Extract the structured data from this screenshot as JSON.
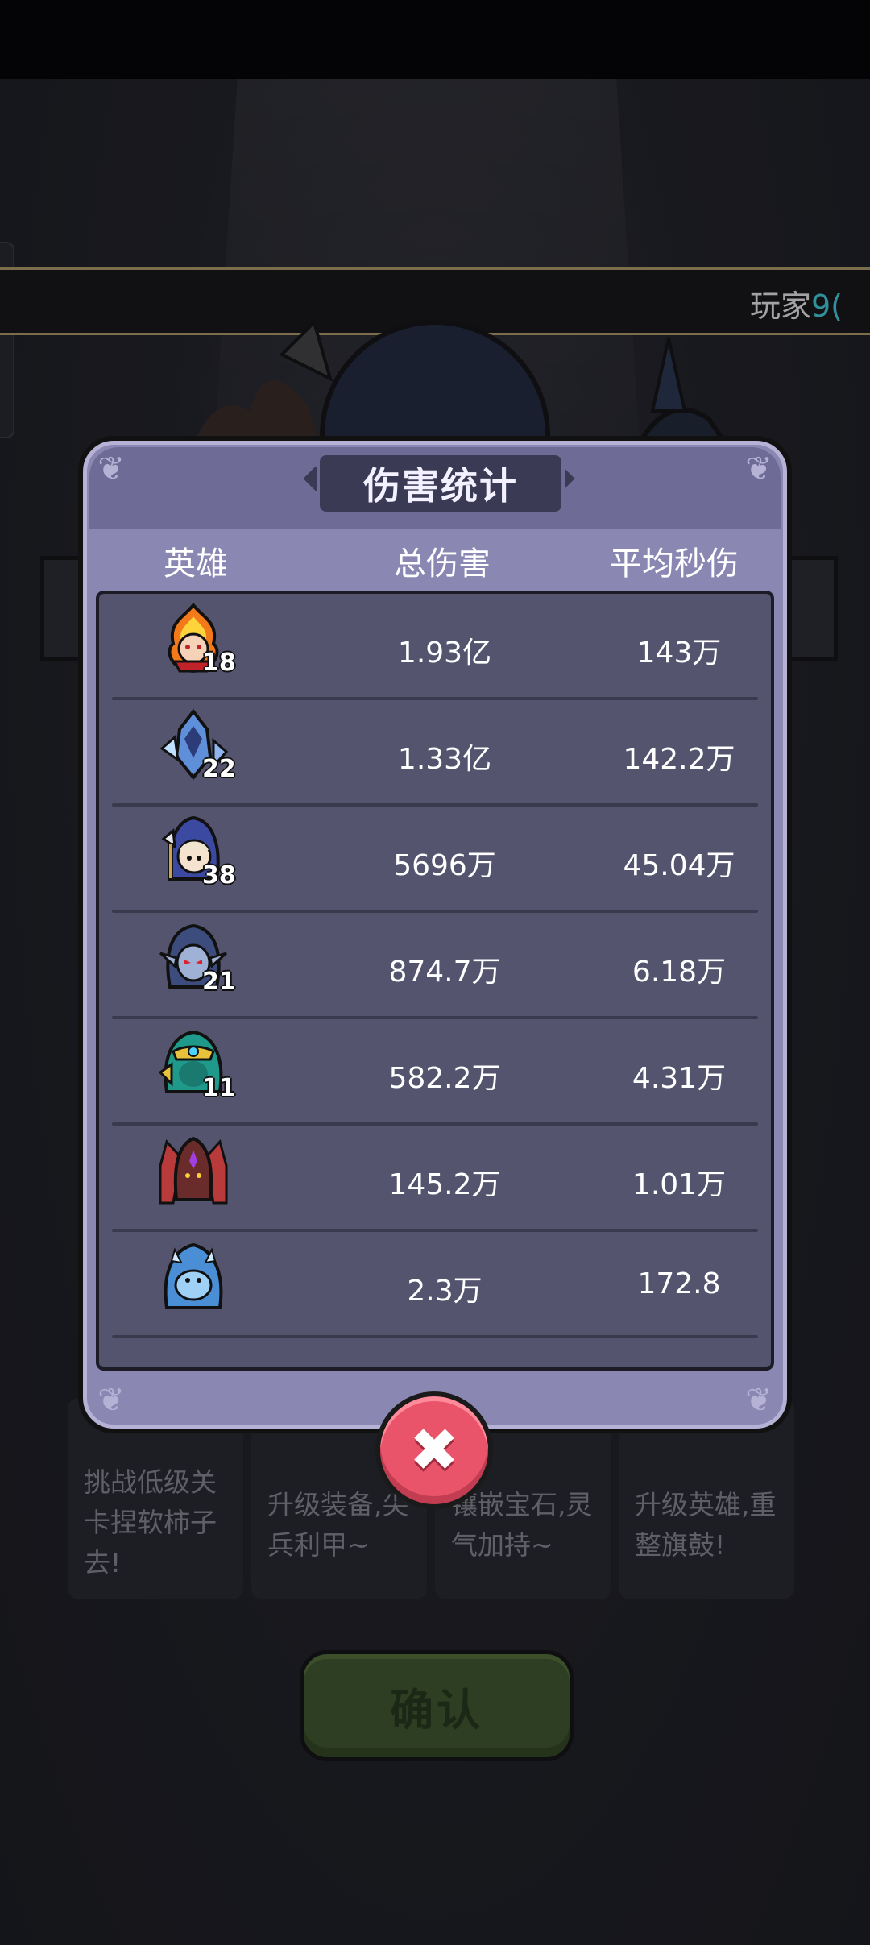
{
  "banner": {
    "player_label": "玩家",
    "player_number": "9("
  },
  "dialog": {
    "title": "伤害统计",
    "headers": {
      "hero": "英雄",
      "total_damage": "总伤害",
      "avg_dps": "平均秒伤"
    },
    "rows": [
      {
        "icon": "fire-hero-icon",
        "level": "18",
        "total": "1.93亿",
        "dps": "143万"
      },
      {
        "icon": "ice-knight-hero-icon",
        "level": "22",
        "total": "1.33亿",
        "dps": "142.2万"
      },
      {
        "icon": "mage-girl-hero-icon",
        "level": "38",
        "total": "5696万",
        "dps": "45.04万"
      },
      {
        "icon": "dark-elf-hero-icon",
        "level": "21",
        "total": "874.7万",
        "dps": "6.18万"
      },
      {
        "icon": "green-sage-hero-icon",
        "level": "11",
        "total": "582.2万",
        "dps": "4.31万"
      },
      {
        "icon": "red-dragon-pet-icon",
        "level": "",
        "total": "145.2万",
        "dps": "1.01万"
      },
      {
        "icon": "ice-dragon-pet-icon",
        "level": "",
        "total": "2.3万",
        "dps": "172.8"
      }
    ]
  },
  "bg_cards": [
    {
      "text": "挑战低级关卡捏软柿子去!"
    },
    {
      "text": "升级装备,尖兵利甲~"
    },
    {
      "text": "镶嵌宝石,灵气加持~"
    },
    {
      "text": "升级英雄,重整旗鼓!"
    }
  ],
  "confirm_label": "确认",
  "close_symbol": "✖"
}
